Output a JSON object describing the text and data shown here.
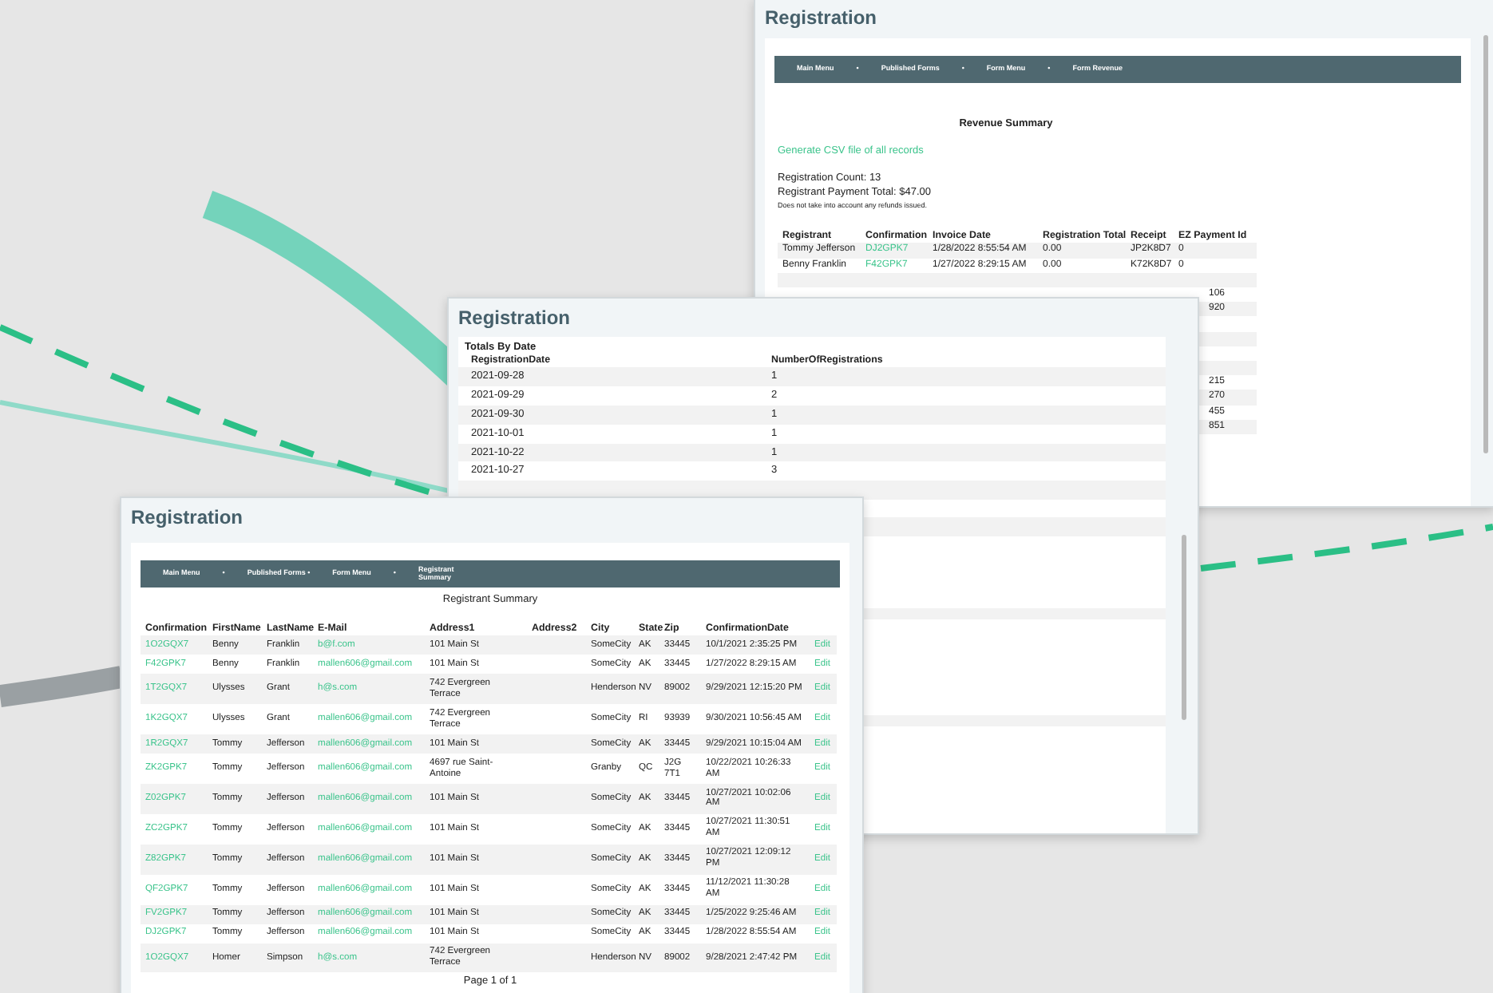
{
  "revenue_window": {
    "title": "Registration",
    "nav": [
      "Main Menu",
      "•",
      "Published Forms",
      "•",
      "Form Menu",
      "•",
      "Form Revenue"
    ],
    "heading": "Revenue Summary",
    "csv_link": "Generate CSV file of all records",
    "registration_count": "Registration Count: 13",
    "payment_total": "Registrant Payment Total: $47.00",
    "note": "Does not take into account any refunds issued.",
    "columns": [
      "Registrant",
      "Confirmation",
      "Invoice Date",
      "Registration Total",
      "Receipt",
      "EZ Payment Id"
    ],
    "rows": [
      {
        "kind": "full",
        "cells": [
          "Tommy Jefferson",
          "DJ2GPK7",
          "1/28/2022 8:55:54 AM",
          "0.00",
          "JP2K8D7",
          "0"
        ]
      },
      {
        "kind": "full",
        "cells": [
          "Benny Franklin",
          "F42GPK7",
          "1/27/2022 8:29:15 AM",
          "0.00",
          "K72K8D7",
          "0"
        ]
      },
      {
        "kind": "covered"
      },
      {
        "kind": "tail",
        "ez_payment_id_end": "106"
      },
      {
        "kind": "tail",
        "ez_payment_id_end": "920"
      },
      {
        "kind": "covered"
      },
      {
        "kind": "covered"
      },
      {
        "kind": "covered"
      },
      {
        "kind": "covered"
      },
      {
        "kind": "tail",
        "ez_payment_id_end": "215"
      },
      {
        "kind": "tail",
        "ez_payment_id_end": "270"
      },
      {
        "kind": "tail",
        "ez_payment_id_end": "455"
      },
      {
        "kind": "tail",
        "ez_payment_id_end": "851"
      }
    ]
  },
  "totals_window": {
    "title": "Registration",
    "panel_title": "Totals By Date",
    "columns": [
      "RegistrationDate",
      "NumberOfRegistrations"
    ],
    "rows": [
      {
        "kind": "full",
        "cells": [
          "2021-09-28",
          "1"
        ]
      },
      {
        "kind": "full",
        "cells": [
          "2021-09-29",
          "2"
        ]
      },
      {
        "kind": "full",
        "cells": [
          "2021-09-30",
          "1"
        ]
      },
      {
        "kind": "full",
        "cells": [
          "2021-10-01",
          "1"
        ]
      },
      {
        "kind": "full",
        "cells": [
          "2021-10-22",
          "1"
        ]
      },
      {
        "kind": "full",
        "cells": [
          "2021-10-27",
          "3"
        ]
      },
      {
        "kind": "covered"
      },
      {
        "kind": "covered"
      },
      {
        "kind": "covered"
      },
      {
        "kind": "covered"
      }
    ]
  },
  "registrant_window": {
    "title": "Registration",
    "nav": [
      "Main Menu",
      "•",
      "Published Forms •",
      "Form Menu",
      "•",
      "Registrant Summary"
    ],
    "heading": "Registrant Summary",
    "columns": [
      "Confirmation",
      "FirstName",
      "LastName",
      "E-Mail",
      "Address1",
      "Address2",
      "City",
      "State",
      "Zip",
      "ConfirmationDate"
    ],
    "rows": [
      {
        "confirmation": "1O2GQX7",
        "first_name": "Benny",
        "last_name": "Franklin",
        "email": "b@f.com",
        "address1": "101 Main St",
        "city": "SomeCity",
        "state": "AK",
        "zip": "33445",
        "date": "10/1/2021 2:35:25 PM",
        "action": "Edit"
      },
      {
        "confirmation": "F42GPK7",
        "first_name": "Benny",
        "last_name": "Franklin",
        "email": "mallen606@gmail.com",
        "address1": "101 Main St",
        "city": "SomeCity",
        "state": "AK",
        "zip": "33445",
        "date": "1/27/2022 8:29:15 AM",
        "action": "Edit"
      },
      {
        "confirmation": "1T2GQX7",
        "first_name": "Ulysses",
        "last_name": "Grant",
        "email": "h@s.com",
        "address1": "742 Evergreen Terrace",
        "city": "Henderson",
        "state": "NV",
        "zip": "89002",
        "date": "9/29/2021 12:15:20 PM",
        "action": "Edit"
      },
      {
        "confirmation": "1K2GQX7",
        "first_name": "Ulysses",
        "last_name": "Grant",
        "email": "mallen606@gmail.com",
        "address1": "742 Evergreen Terrace",
        "city": "SomeCity",
        "state": "RI",
        "zip": "93939",
        "date": "9/30/2021 10:56:45 AM",
        "action": "Edit"
      },
      {
        "confirmation": "1R2GQX7",
        "first_name": "Tommy",
        "last_name": "Jefferson",
        "email": "mallen606@gmail.com",
        "address1": "101 Main St",
        "city": "SomeCity",
        "state": "AK",
        "zip": "33445",
        "date": "9/29/2021 10:15:04 AM",
        "action": "Edit"
      },
      {
        "confirmation": "ZK2GPK7",
        "first_name": "Tommy",
        "last_name": "Jefferson",
        "email": "mallen606@gmail.com",
        "address1": "4697 rue Saint-Antoine",
        "city": "Granby",
        "state": "QC",
        "zip": "J2G 7T1",
        "date": "10/22/2021 10:26:33 AM",
        "action": "Edit"
      },
      {
        "confirmation": "Z02GPK7",
        "first_name": "Tommy",
        "last_name": "Jefferson",
        "email": "mallen606@gmail.com",
        "address1": "101 Main St",
        "city": "SomeCity",
        "state": "AK",
        "zip": "33445",
        "date": "10/27/2021 10:02:06 AM",
        "action": "Edit"
      },
      {
        "confirmation": "ZC2GPK7",
        "first_name": "Tommy",
        "last_name": "Jefferson",
        "email": "mallen606@gmail.com",
        "address1": "101 Main St",
        "city": "SomeCity",
        "state": "AK",
        "zip": "33445",
        "date": "10/27/2021 11:30:51 AM",
        "action": "Edit"
      },
      {
        "confirmation": "Z82GPK7",
        "first_name": "Tommy",
        "last_name": "Jefferson",
        "email": "mallen606@gmail.com",
        "address1": "101 Main St",
        "city": "SomeCity",
        "state": "AK",
        "zip": "33445",
        "date": "10/27/2021 12:09:12 PM",
        "action": "Edit"
      },
      {
        "confirmation": "QF2GPK7",
        "first_name": "Tommy",
        "last_name": "Jefferson",
        "email": "mallen606@gmail.com",
        "address1": "101 Main St",
        "city": "SomeCity",
        "state": "AK",
        "zip": "33445",
        "date": "11/12/2021 11:30:28 AM",
        "action": "Edit"
      },
      {
        "confirmation": "FV2GPK7",
        "first_name": "Tommy",
        "last_name": "Jefferson",
        "email": "mallen606@gmail.com",
        "address1": "101 Main St",
        "city": "SomeCity",
        "state": "AK",
        "zip": "33445",
        "date": "1/25/2022 9:25:46 AM",
        "action": "Edit"
      },
      {
        "confirmation": "DJ2GPK7",
        "first_name": "Tommy",
        "last_name": "Jefferson",
        "email": "mallen606@gmail.com",
        "address1": "101 Main St",
        "city": "SomeCity",
        "state": "AK",
        "zip": "33445",
        "date": "1/28/2022 8:55:54 AM",
        "action": "Edit"
      },
      {
        "confirmation": "1O2GQX7",
        "first_name": "Homer",
        "last_name": "Simpson",
        "email": "h@s.com",
        "address1": "742 Evergreen Terrace",
        "city": "Henderson",
        "state": "NV",
        "zip": "89002",
        "date": "9/28/2021 2:47:42 PM",
        "action": "Edit"
      }
    ],
    "pager": "Page 1 of 1"
  }
}
